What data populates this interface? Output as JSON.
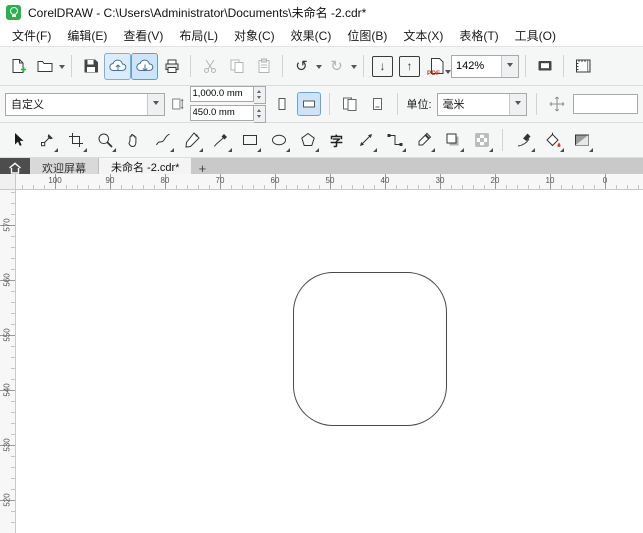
{
  "window": {
    "app_title": "CorelDRAW - C:\\Users\\Administrator\\Documents\\未命名 -2.cdr*"
  },
  "menu": {
    "items": [
      "文件(F)",
      "编辑(E)",
      "查看(V)",
      "布局(L)",
      "对象(C)",
      "效果(C)",
      "位图(B)",
      "文本(X)",
      "表格(T)",
      "工具(O)"
    ]
  },
  "toolbar": {
    "zoom_level": "142%"
  },
  "icons": {
    "undo": "↺",
    "redo": "↻",
    "import": "↓",
    "export": "↑",
    "pdf": "PDF",
    "text_tool": "字"
  },
  "property_bar": {
    "preset": "自定义",
    "page_width": "1,000.0 mm",
    "page_height": "450.0 mm",
    "units_label": "单位:",
    "units_value": "毫米"
  },
  "tab_bar": {
    "welcome_tab": "欢迎屏幕",
    "document_tab": "未命名 -2.cdr*",
    "new_tab": "+"
  },
  "rulers": {
    "horizontal": [
      "100",
      "90",
      "80",
      "70",
      "60",
      "50",
      "40",
      "30",
      "20",
      "10",
      "0"
    ],
    "vertical": [
      "570",
      "560",
      "550",
      "540",
      "530",
      "520"
    ]
  },
  "canvas": {
    "shape": "rounded-square-outline"
  },
  "colors": {
    "accent_teal": "#00a98f",
    "logo_green": "#28b24c",
    "selection_blue": "#7ab0dd"
  }
}
